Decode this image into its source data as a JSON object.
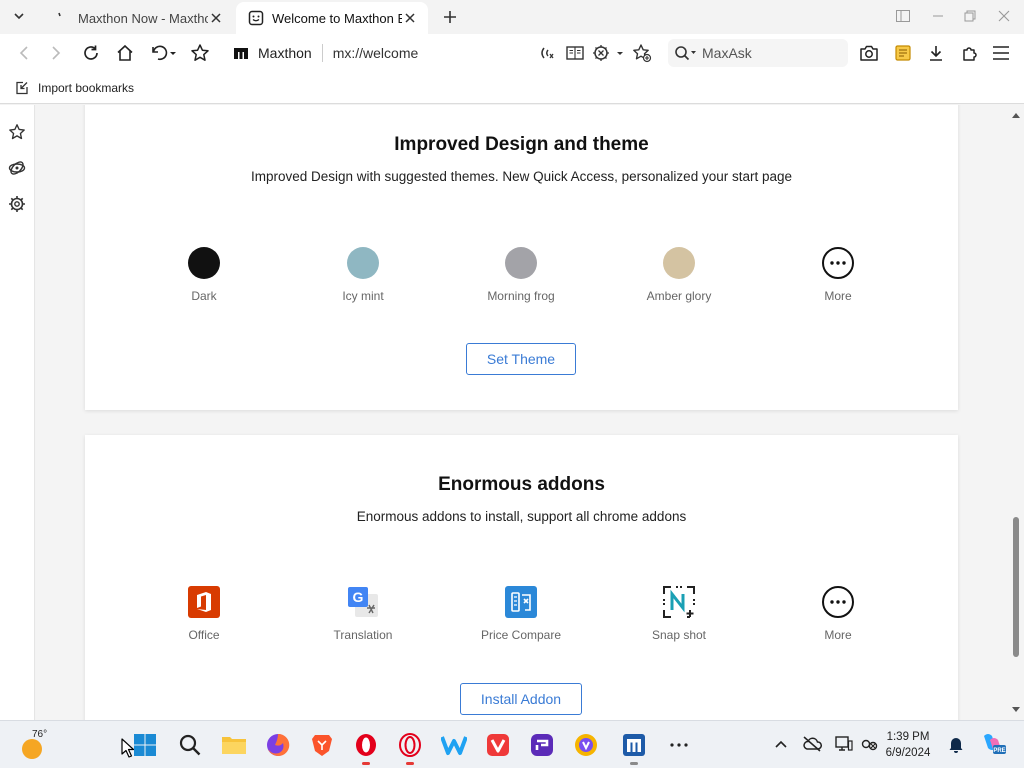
{
  "tabs": [
    {
      "title": "Maxthon Now - Maxthon",
      "active": false
    },
    {
      "title": "Welcome to Maxthon Br",
      "active": true
    }
  ],
  "toolbar": {
    "site_name": "Maxthon",
    "url": "mx://welcome",
    "search_label": "MaxAsk"
  },
  "bookmarks_bar": {
    "import_label": "Import bookmarks"
  },
  "theme_section": {
    "title": "Improved Design and theme",
    "subtitle": "Improved Design with suggested themes. New Quick Access, personalized your start page",
    "themes": [
      {
        "label": "Dark",
        "color": "#111111"
      },
      {
        "label": "Icy mint",
        "color": "#8fb7c2"
      },
      {
        "label": "Morning frog",
        "color": "#a3a3a8"
      },
      {
        "label": "Amber glory",
        "color": "#d4c3a2"
      },
      {
        "label": "More",
        "color": "#ffffff"
      }
    ],
    "button_label": "Set Theme"
  },
  "addons_section": {
    "title": "Enormous addons",
    "subtitle": "Enormous addons to install, support all chrome addons",
    "addons": [
      {
        "label": "Office",
        "icon": "office-icon"
      },
      {
        "label": "Translation",
        "icon": "google-translate-icon"
      },
      {
        "label": "Price Compare",
        "icon": "price-compare-icon"
      },
      {
        "label": "Snap shot",
        "icon": "snapshot-icon"
      },
      {
        "label": "More",
        "icon": "more-icon"
      }
    ],
    "button_label": "Install Addon"
  },
  "taskbar": {
    "weather_temp": "76°",
    "time": "1:39 PM",
    "date": "6/9/2024"
  },
  "colors": {
    "accent_blue": "#3a7bd5",
    "maxthon_blue": "#1e5ba8"
  }
}
